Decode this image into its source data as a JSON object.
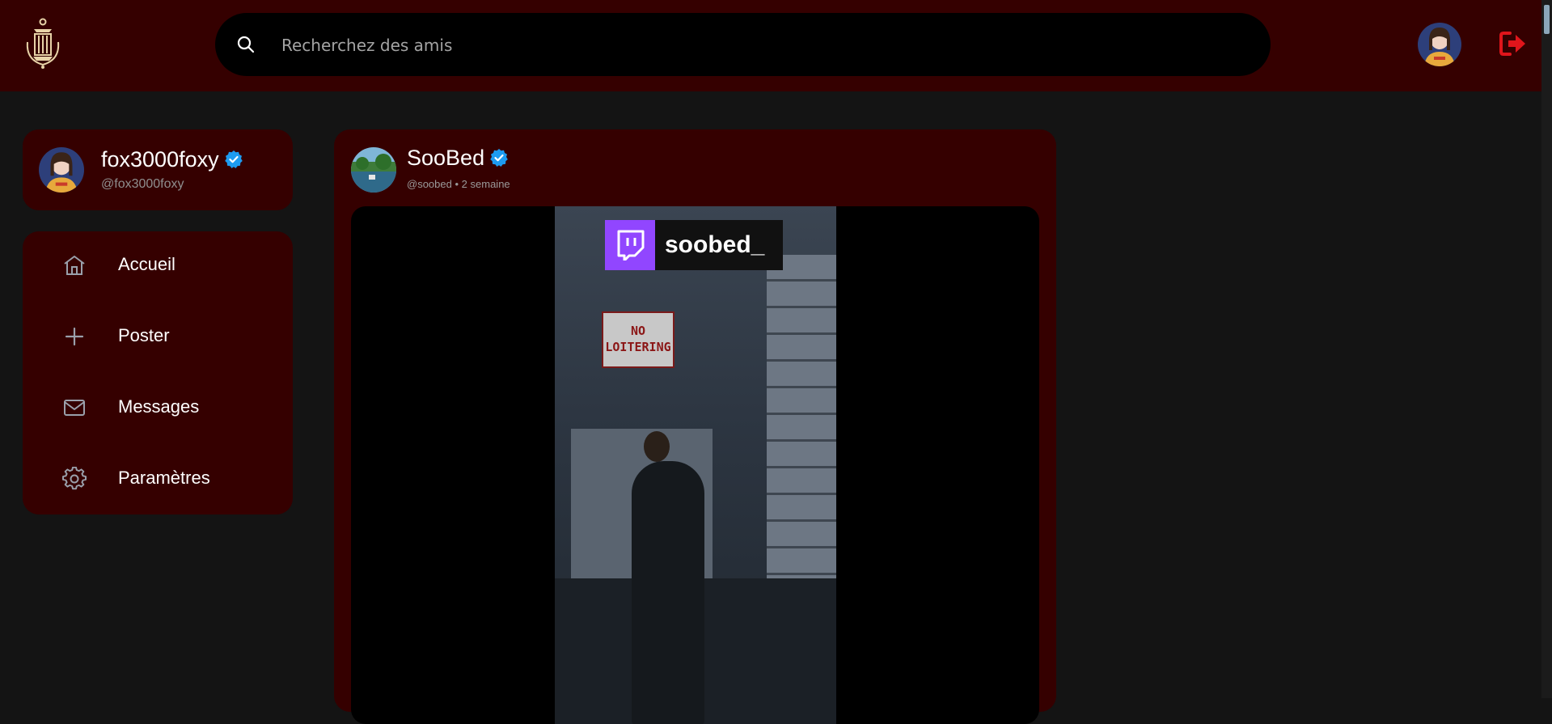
{
  "header": {
    "logo_icon": "lantern-logo-icon",
    "search": {
      "placeholder": "Recherchez des amis",
      "value": ""
    },
    "avatar_icon": "user-avatar",
    "logout_icon": "logout-icon"
  },
  "profile": {
    "name": "fox3000foxy",
    "handle": "@fox3000foxy",
    "verified": true
  },
  "nav": {
    "items": [
      {
        "label": "Accueil",
        "icon": "home-icon"
      },
      {
        "label": "Poster",
        "icon": "plus-icon"
      },
      {
        "label": "Messages",
        "icon": "mail-icon"
      },
      {
        "label": "Paramètres",
        "icon": "gear-icon"
      }
    ]
  },
  "post": {
    "author": "SooBed",
    "handle": "@soobed",
    "separator": "•",
    "time": "2 semaine",
    "verified": true,
    "media": {
      "overlay_channel": "soobed_",
      "overlay_icon": "twitch-icon",
      "sign_text": "NO LOITERING"
    }
  },
  "colors": {
    "panel": "#350000",
    "background": "#141414",
    "accent_logout": "#e0151b",
    "verified": "#1d9bf0",
    "twitch": "#9146ff"
  }
}
